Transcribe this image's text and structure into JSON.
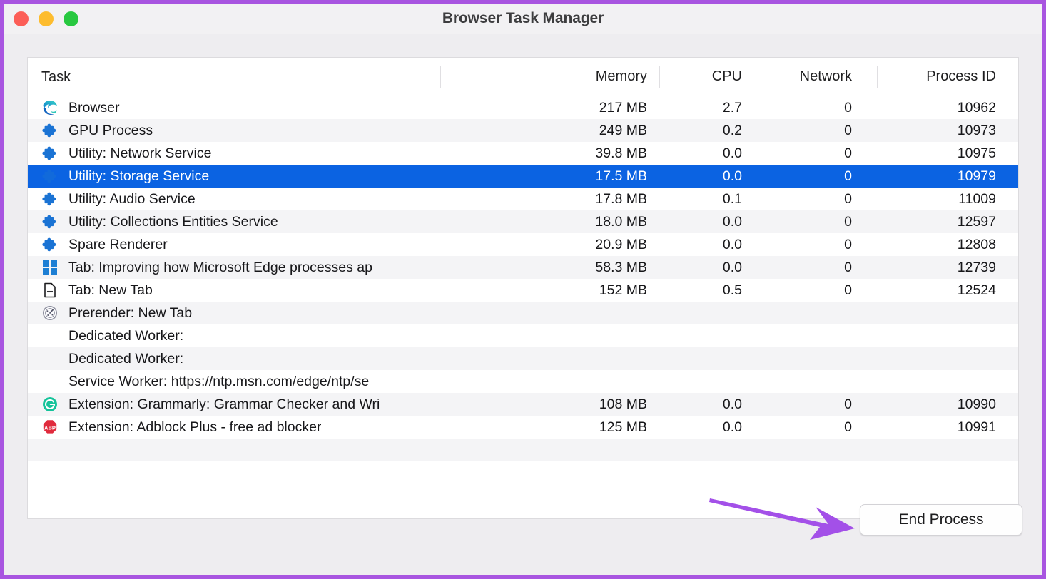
{
  "window": {
    "title": "Browser Task Manager",
    "traffic_lights": [
      {
        "name": "close",
        "color": "#fc5e57"
      },
      {
        "name": "minimize",
        "color": "#fdbc2e"
      },
      {
        "name": "maximize",
        "color": "#28c840"
      }
    ],
    "border_color": "#a855e0"
  },
  "table": {
    "columns": [
      {
        "key": "task",
        "label": "Task",
        "align": "left"
      },
      {
        "key": "memory",
        "label": "Memory",
        "align": "right"
      },
      {
        "key": "cpu",
        "label": "CPU",
        "align": "right"
      },
      {
        "key": "network",
        "label": "Network",
        "align": "right"
      },
      {
        "key": "pid",
        "label": "Process ID",
        "align": "right"
      }
    ],
    "selection_color": "#0b63e2",
    "rows": [
      {
        "icon": "edge-browser-icon",
        "task": "Browser",
        "memory": "217 MB",
        "cpu": "2.7",
        "network": "0",
        "pid": "10962",
        "selected": false
      },
      {
        "icon": "puzzle-piece-icon",
        "task": "GPU Process",
        "memory": "249 MB",
        "cpu": "0.2",
        "network": "0",
        "pid": "10973",
        "selected": false
      },
      {
        "icon": "puzzle-piece-icon",
        "task": "Utility: Network Service",
        "memory": "39.8 MB",
        "cpu": "0.0",
        "network": "0",
        "pid": "10975",
        "selected": false
      },
      {
        "icon": "puzzle-piece-icon",
        "task": "Utility: Storage Service",
        "memory": "17.5 MB",
        "cpu": "0.0",
        "network": "0",
        "pid": "10979",
        "selected": true
      },
      {
        "icon": "puzzle-piece-icon",
        "task": "Utility: Audio Service",
        "memory": "17.8 MB",
        "cpu": "0.1",
        "network": "0",
        "pid": "11009",
        "selected": false
      },
      {
        "icon": "puzzle-piece-icon",
        "task": "Utility: Collections Entities Service",
        "memory": "18.0 MB",
        "cpu": "0.0",
        "network": "0",
        "pid": "12597",
        "selected": false
      },
      {
        "icon": "puzzle-piece-icon",
        "task": "Spare Renderer",
        "memory": "20.9 MB",
        "cpu": "0.0",
        "network": "0",
        "pid": "12808",
        "selected": false
      },
      {
        "icon": "microsoft-windows-icon",
        "task": "Tab: Improving how Microsoft Edge processes ap",
        "memory": "58.3 MB",
        "cpu": "0.0",
        "network": "0",
        "pid": "12739",
        "selected": false
      },
      {
        "icon": "new-tab-page-icon",
        "task": "Tab: New Tab",
        "memory": "152 MB",
        "cpu": "0.5",
        "network": "0",
        "pid": "12524",
        "selected": false
      },
      {
        "icon": "speedometer-icon",
        "task": "Prerender: New Tab",
        "memory": "",
        "cpu": "",
        "network": "",
        "pid": "",
        "selected": false
      },
      {
        "icon": "none",
        "task": "Dedicated Worker:",
        "memory": "",
        "cpu": "",
        "network": "",
        "pid": "",
        "selected": false
      },
      {
        "icon": "none",
        "task": "Dedicated Worker:",
        "memory": "",
        "cpu": "",
        "network": "",
        "pid": "",
        "selected": false
      },
      {
        "icon": "none",
        "task": "Service Worker: https://ntp.msn.com/edge/ntp/se",
        "memory": "",
        "cpu": "",
        "network": "",
        "pid": "",
        "selected": false
      },
      {
        "icon": "grammarly-icon",
        "task": "Extension: Grammarly: Grammar Checker and Wri",
        "memory": "108 MB",
        "cpu": "0.0",
        "network": "0",
        "pid": "10990",
        "selected": false
      },
      {
        "icon": "adblock-plus-icon",
        "task": "Extension: Adblock Plus - free ad blocker",
        "memory": "125 MB",
        "cpu": "0.0",
        "network": "0",
        "pid": "10991",
        "selected": false
      },
      {
        "icon": "none",
        "task": "",
        "memory": "",
        "cpu": "",
        "network": "",
        "pid": "",
        "selected": false
      },
      {
        "icon": "none",
        "task": "",
        "memory": "",
        "cpu": "",
        "network": "",
        "pid": "",
        "selected": false
      }
    ]
  },
  "footer": {
    "end_process_label": "End Process",
    "annotation_arrow_color": "#a350e8"
  }
}
